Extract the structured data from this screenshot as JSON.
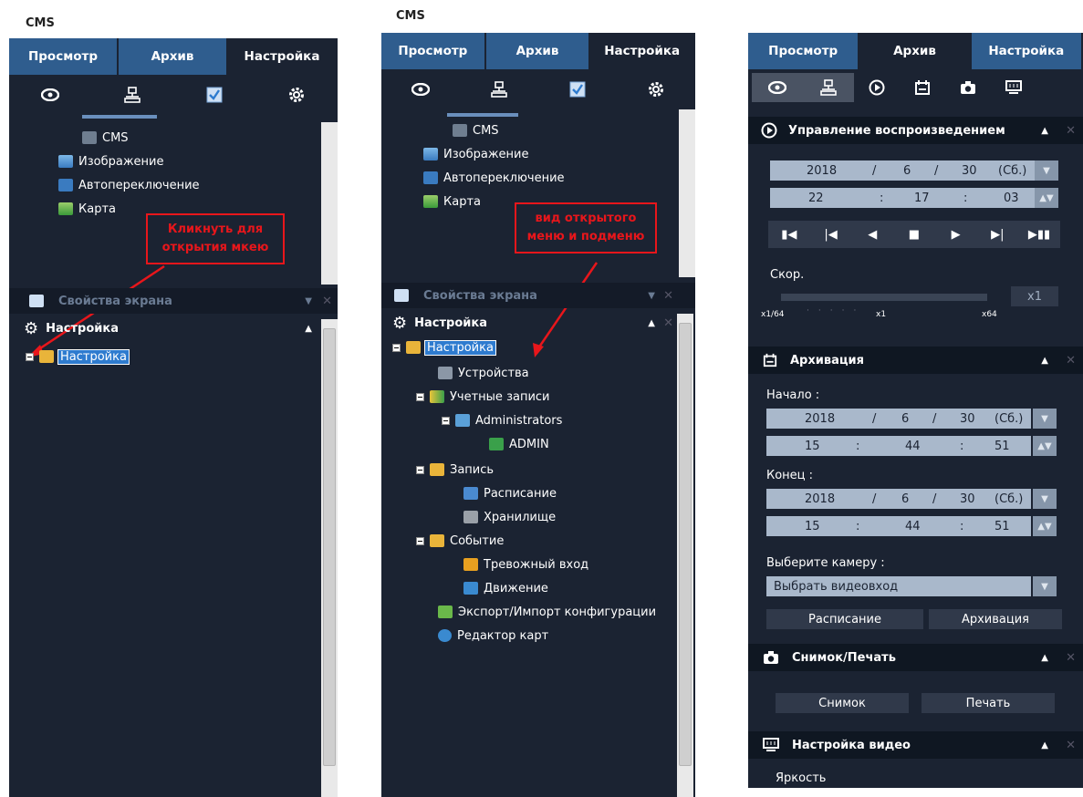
{
  "panel1": {
    "app_title": "CMS",
    "tabs": [
      "Просмотр",
      "Архив",
      "Настройка"
    ],
    "tree": {
      "cms": "CMS",
      "image": "Изображение",
      "autoswitch": "Автопереключение",
      "map": "Карта"
    },
    "callout": "Кликнуть для открытия мкею",
    "sections": {
      "screen_props": "Свойства экрана",
      "settings": "Настройка"
    },
    "settings_node": "Настройка"
  },
  "panel2": {
    "app_title": "CMS",
    "tabs": [
      "Просмотр",
      "Архив",
      "Настройка"
    ],
    "tree": {
      "cms": "CMS",
      "image": "Изображение",
      "autoswitch": "Автопереключение",
      "map": "Карта"
    },
    "callout": "вид открытого меню и подменю",
    "sections": {
      "screen_props": "Свойства экрана",
      "settings": "Настройка"
    },
    "settings_tree": {
      "root": "Настройка",
      "devices": "Устройства",
      "accounts": "Учетные записи",
      "administrators": "Administrators",
      "admin": "ADMIN",
      "record": "Запись",
      "schedule": "Расписание",
      "storage": "Хранилище",
      "event": "Событие",
      "alarm_input": "Тревожный вход",
      "motion": "Движение",
      "export_import": "Экспорт/Импорт конфигурации",
      "map_editor": "Редактор карт"
    }
  },
  "panel3": {
    "tabs": [
      "Просмотр",
      "Архив",
      "Настройка"
    ],
    "playback": {
      "title": "Управление воспроизведением",
      "date": {
        "year": "2018",
        "sep1": "/",
        "month": "6",
        "sep2": "/",
        "day": "30",
        "dow": "(Сб.)"
      },
      "time": {
        "h": "22",
        "sep1": ":",
        "m": "17",
        "sep2": ":",
        "s": "03"
      },
      "speed_label": "Скор.",
      "speed_value": "x1",
      "scale_min": "x1/64",
      "scale_mid": "x1",
      "scale_max": "x64"
    },
    "archive": {
      "title": "Архивация",
      "start_label": "Начало :",
      "start_date": {
        "year": "2018",
        "sep1": "/",
        "month": "6",
        "sep2": "/",
        "day": "30",
        "dow": "(Сб.)"
      },
      "start_time": {
        "h": "15",
        "sep1": ":",
        "m": "44",
        "sep2": ":",
        "s": "51"
      },
      "end_label": "Конец :",
      "end_date": {
        "year": "2018",
        "sep1": "/",
        "month": "6",
        "sep2": "/",
        "day": "30",
        "dow": "(Сб.)"
      },
      "end_time": {
        "h": "15",
        "sep1": ":",
        "m": "44",
        "sep2": ":",
        "s": "51"
      },
      "camera_label": "Выберите камеру :",
      "camera_select": "Выбрать видеовход",
      "schedule_btn": "Расписание",
      "archive_btn": "Архивация"
    },
    "snapshot": {
      "title": "Снимок/Печать",
      "snap_btn": "Снимок",
      "print_btn": "Печать"
    },
    "video": {
      "title": "Настройка видео",
      "brightness": "Яркость"
    }
  },
  "colors": {
    "panel_bg": "#1b2332",
    "tab_blue": "#2f5d8e",
    "header_bg": "#0f1722",
    "callout_red": "#e8161b",
    "field_bg": "#a9b8cb"
  }
}
